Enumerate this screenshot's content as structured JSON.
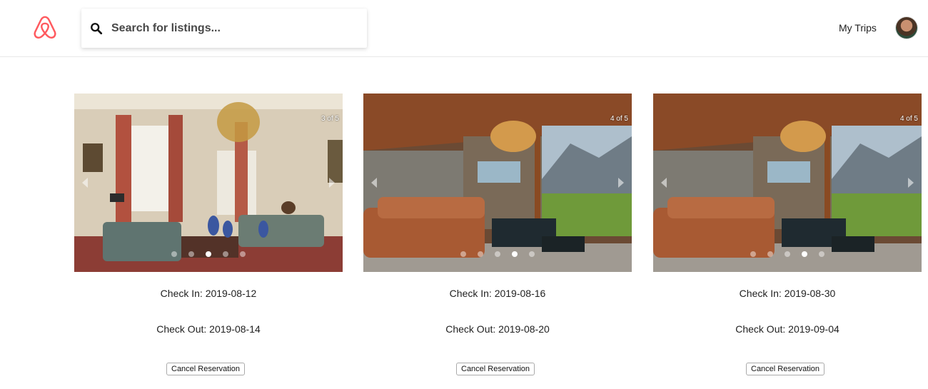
{
  "header": {
    "search": {
      "placeholder": "Search for listings..."
    },
    "my_trips_label": "My Trips",
    "brand_color": "#FF5A5F"
  },
  "reservations": [
    {
      "photo_counter": "3 of 5",
      "photo_index": 3,
      "photo_total": 5,
      "check_in": "Check In: 2019-08-12",
      "check_out": "Check Out: 2019-08-14",
      "cancel_label": "Cancel Reservation"
    },
    {
      "photo_counter": "4 of 5",
      "photo_index": 4,
      "photo_total": 5,
      "check_in": "Check In: 2019-08-16",
      "check_out": "Check Out: 2019-08-20",
      "cancel_label": "Cancel Reservation"
    },
    {
      "photo_counter": "4 of 5",
      "photo_index": 4,
      "photo_total": 5,
      "check_in": "Check In: 2019-08-30",
      "check_out": "Check Out: 2019-09-04",
      "cancel_label": "Cancel Reservation"
    }
  ]
}
